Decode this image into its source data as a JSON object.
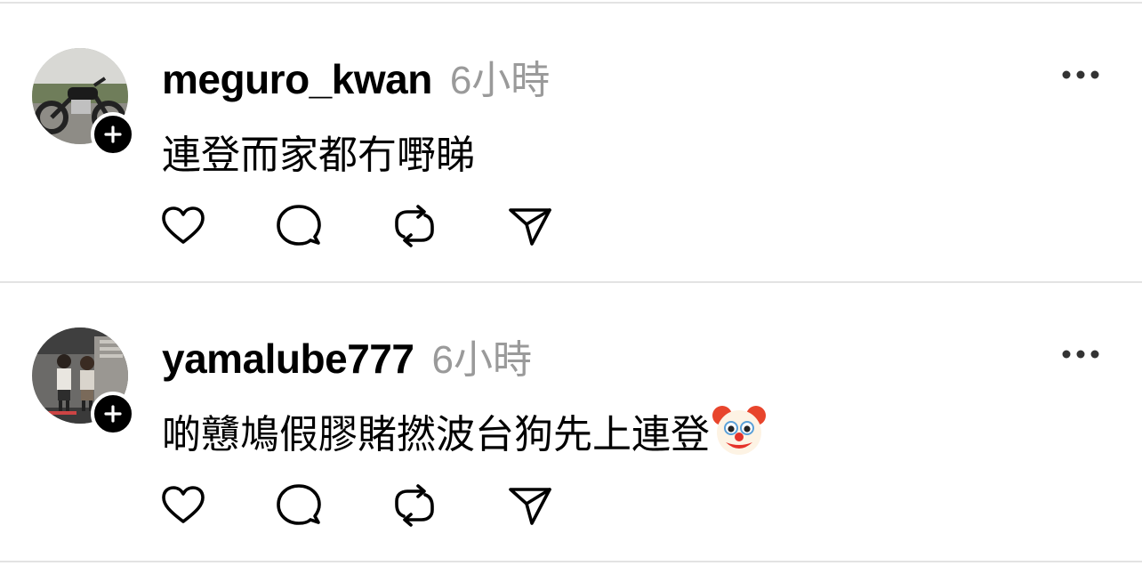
{
  "posts": [
    {
      "username": "meguro_kwan",
      "time": "6小時",
      "text": "連登而家都冇嘢睇",
      "avatar_icon": "avatar-motorcycle-photo",
      "follow_icon": "plus-icon",
      "more_icon": "more-dots-icon",
      "actions": [
        "heart-icon",
        "comment-icon",
        "repost-icon",
        "share-icon"
      ]
    },
    {
      "username": "yamalube777",
      "time": "6小時",
      "text": "啲戇鳩假膠賭撚波台狗先上連登",
      "emoji": "🤡",
      "avatar_icon": "avatar-people-photo",
      "follow_icon": "plus-icon",
      "more_icon": "more-dots-icon",
      "actions": [
        "heart-icon",
        "comment-icon",
        "repost-icon",
        "share-icon"
      ]
    }
  ],
  "colors": {
    "text": "#000000",
    "muted": "#9a9a9a",
    "divider": "#e3e3e3",
    "background": "#ffffff"
  }
}
